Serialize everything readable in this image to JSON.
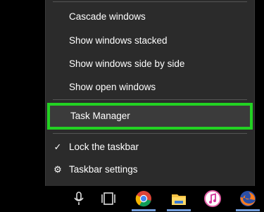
{
  "menu": {
    "items": [
      {
        "label": "Cascade windows"
      },
      {
        "label": "Show windows stacked"
      },
      {
        "label": "Show windows side by side"
      },
      {
        "label": "Show open windows"
      },
      {
        "label": "Task Manager"
      },
      {
        "label": "Lock the taskbar",
        "checked": true,
        "icon": "checkmark-icon"
      },
      {
        "label": "Taskbar settings",
        "icon": "gear-icon"
      }
    ],
    "highlight_color": "#22d222",
    "background_color": "#2b2b2b"
  },
  "taskbar": {
    "icons": [
      "microphone-icon",
      "task-view-icon",
      "chrome-icon",
      "file-explorer-icon",
      "itunes-icon",
      "firefox-icon"
    ],
    "active_indicator_color": "#6f9ad8"
  }
}
